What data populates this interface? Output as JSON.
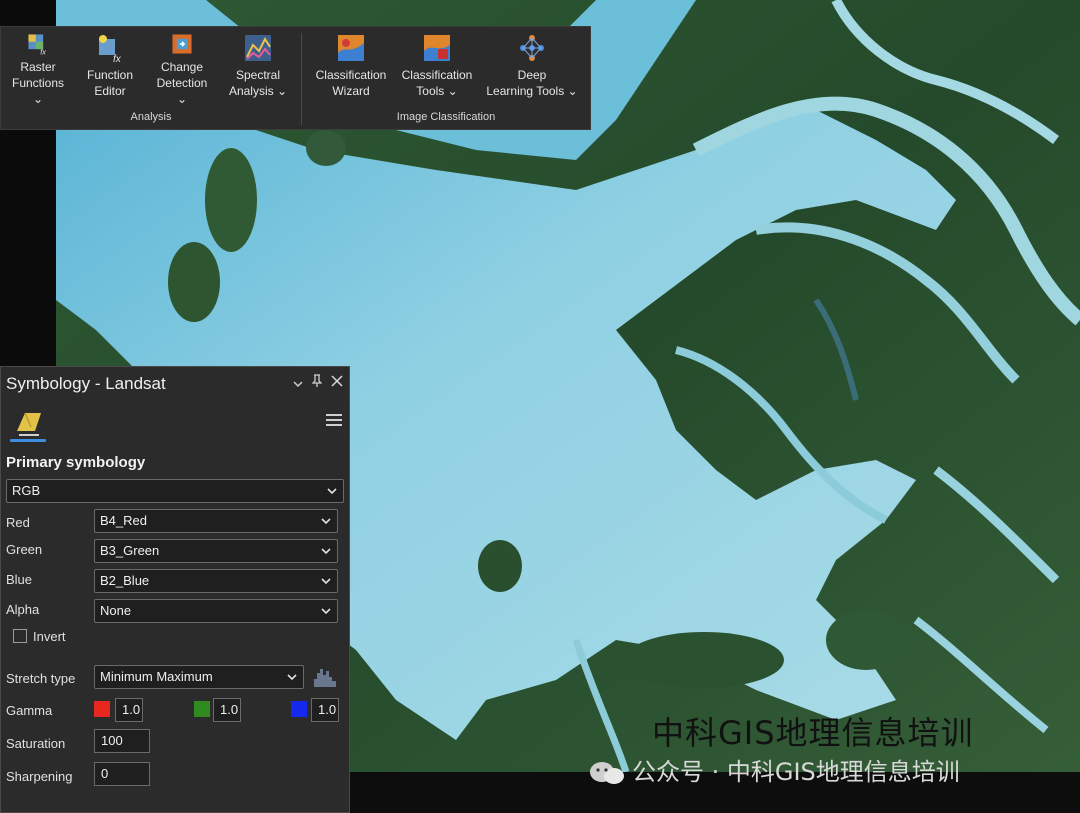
{
  "ribbon": {
    "groups": [
      {
        "label": "Analysis"
      },
      {
        "label": "Image Classification"
      }
    ],
    "buttons": [
      {
        "line1": "Raster",
        "line2": "Functions ⌄",
        "icon": "raster-functions-icon"
      },
      {
        "line1": "Function",
        "line2": "Editor",
        "icon": "function-editor-icon"
      },
      {
        "line1": "Change",
        "line2": "Detection ⌄",
        "icon": "change-detection-icon"
      },
      {
        "line1": "Spectral",
        "line2": "Analysis ⌄",
        "icon": "spectral-analysis-icon"
      },
      {
        "line1": "Classification",
        "line2": "Wizard",
        "icon": "classification-wizard-icon"
      },
      {
        "line1": "Classification",
        "line2": "Tools ⌄",
        "icon": "classification-tools-icon"
      },
      {
        "line1": "Deep",
        "line2": "Learning Tools ⌄",
        "icon": "deep-learning-icon"
      }
    ]
  },
  "pane": {
    "title": "Symbology - Landsat",
    "primary_heading": "Primary symbology",
    "renderer": "RGB",
    "bands": {
      "red_label": "Red",
      "red_value": "B4_Red",
      "green_label": "Green",
      "green_value": "B3_Green",
      "blue_label": "Blue",
      "blue_value": "B2_Blue",
      "alpha_label": "Alpha",
      "alpha_value": "None"
    },
    "invert_label": "Invert",
    "stretch_label": "Stretch type",
    "stretch_value": "Minimum Maximum",
    "gamma_label": "Gamma",
    "gamma_red": "1.0",
    "gamma_green": "1.0",
    "gamma_blue": "1.0",
    "saturation_label": "Saturation",
    "saturation_value": "100",
    "sharpening_label": "Sharpening",
    "sharpening_value": "0",
    "colors": {
      "red": "#e8281e",
      "green": "#2f8a1f",
      "blue": "#1428f0"
    }
  },
  "watermark": {
    "main": "中科GIS地理信息培训",
    "line": "公众号 · 中科GIS地理信息培训"
  }
}
